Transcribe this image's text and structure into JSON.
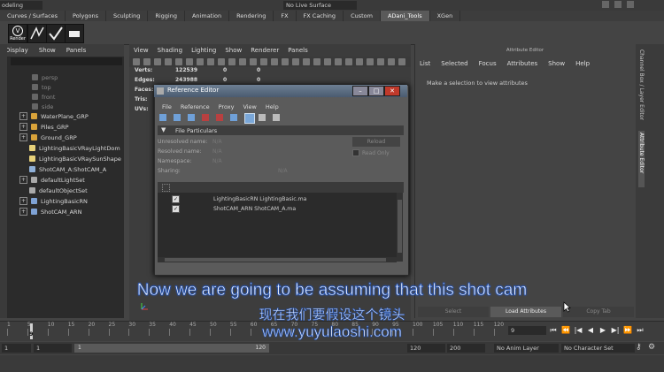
{
  "topbar": {
    "mode": "odeling",
    "live_surface": "No Live Surface"
  },
  "shelf_tabs": [
    "Curves / Surfaces",
    "Polygons",
    "Sculpting",
    "Rigging",
    "Animation",
    "Rendering",
    "FX",
    "FX Caching",
    "Custom",
    "ADani_Tools",
    "XGen"
  ],
  "shelf_active": "ADani_Tools",
  "shelf_icon_label": "Render",
  "outliner": {
    "menu": [
      "Display",
      "Show",
      "Panels"
    ],
    "cameras": [
      "persp",
      "top",
      "front",
      "side"
    ],
    "items": [
      {
        "label": "WaterPlane_GRP",
        "expand": "+",
        "color": "#d9a33a"
      },
      {
        "label": "Piles_GRP",
        "expand": "+",
        "color": "#d9a33a"
      },
      {
        "label": "Ground_GRP",
        "expand": "+",
        "color": "#d9a33a"
      },
      {
        "label": "LightingBasicVRayLightDom",
        "expand": "",
        "color": "#e8d27a"
      },
      {
        "label": "LightingBasicVRaySunShape",
        "expand": "",
        "color": "#e8d27a"
      },
      {
        "label": "ShotCAM_A:ShotCAM_A",
        "expand": "",
        "color": "#8fb0d8"
      },
      {
        "label": "defaultLightSet",
        "expand": "+",
        "color": "#aaaaaa"
      },
      {
        "label": "defaultObjectSet",
        "expand": "",
        "color": "#aaaaaa"
      },
      {
        "label": "LightingBasicRN",
        "expand": "+",
        "color": "#7fa3d6"
      },
      {
        "label": "ShotCAM_ARN",
        "expand": "+",
        "color": "#7fa3d6"
      }
    ]
  },
  "viewport": {
    "menu": [
      "View",
      "Shading",
      "Lighting",
      "Show",
      "Renderer",
      "Panels"
    ],
    "hud": [
      {
        "label": "Verts:",
        "v1": "122539",
        "v2": "0",
        "v3": "0"
      },
      {
        "label": "Edges:",
        "v1": "243988",
        "v2": "0",
        "v3": "0"
      },
      {
        "label": "Faces:",
        "v1": "",
        "v2": "",
        "v3": ""
      },
      {
        "label": "Tris:",
        "v1": "",
        "v2": "",
        "v3": ""
      },
      {
        "label": "UVs:",
        "v1": "",
        "v2": "",
        "v3": ""
      }
    ]
  },
  "reference_editor": {
    "title": "Reference Editor",
    "menu": [
      "File",
      "Reference",
      "Proxy",
      "View",
      "Help"
    ],
    "section": "File Particulars",
    "fields": [
      {
        "label": "Unresolved name:",
        "value": "N/A"
      },
      {
        "label": "Resolved name:",
        "value": "N/A"
      },
      {
        "label": "Namespace:",
        "value": "N/A"
      },
      {
        "label": "Sharing:",
        "value": "N/A"
      }
    ],
    "reload_label": "Reload",
    "read_only_label": "Read Only",
    "references": [
      {
        "checked": true,
        "name": "LightingBasicRN LightingBasic.ma"
      },
      {
        "checked": true,
        "name": "ShotCAM_ARN ShotCAM_A.ma"
      }
    ]
  },
  "attribute_editor": {
    "title": "Attribute Editor",
    "menu": [
      "List",
      "Selected",
      "Focus",
      "Attributes",
      "Show",
      "Help"
    ],
    "message": "Make a selection to view attributes",
    "buttons": [
      "Select",
      "Load Attributes",
      "Copy Tab"
    ]
  },
  "side_tabs": [
    "Channel Box / Layer Editor",
    "Attribute Editor"
  ],
  "timeline": {
    "ticks": [
      "1",
      "5",
      "10",
      "15",
      "20",
      "25",
      "30",
      "35",
      "40",
      "45",
      "50",
      "55",
      "60",
      "65",
      "70",
      "75",
      "80",
      "85",
      "90",
      "95",
      "100",
      "105",
      "110",
      "115",
      "120"
    ],
    "current_frame_marker": "9",
    "current_frame": "9",
    "range_start": "1",
    "range_inner_start": "1",
    "range_slider_start": "1",
    "range_slider_end": "120",
    "range_inner_end": "120",
    "range_end": "200",
    "anim_layer": "No Anim Layer",
    "character_set": "No Character Set"
  },
  "subtitles": {
    "english": "Now we are going to be assuming that this shot cam",
    "chinese": "现在我们要假设这个镜头",
    "url": "www.yuyulaoshi.com"
  }
}
